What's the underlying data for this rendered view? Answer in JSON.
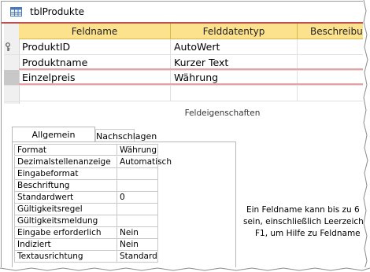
{
  "window": {
    "title": "tblProdukte",
    "icon": "table-icon"
  },
  "grid": {
    "columns": [
      "Feldname",
      "Felddatentyp",
      "Beschreibu"
    ],
    "rows": [
      {
        "name": "ProduktID",
        "type": "AutoWert",
        "description": "",
        "key": true
      },
      {
        "name": "Produktname",
        "type": "Kurzer Text",
        "description": "",
        "key": false
      },
      {
        "name": "Einzelpreis",
        "type": "Währung",
        "description": "",
        "key": false,
        "selected": true
      }
    ],
    "header_color": "#fde28d",
    "selection_color": "#e8a0a2"
  },
  "properties_section_label": "Feldeigenschaften",
  "tabs": [
    {
      "label": "Allgemein",
      "active": true
    },
    {
      "label": "Nachschlagen",
      "active": false
    }
  ],
  "properties": [
    {
      "name": "Format",
      "value": "Währung"
    },
    {
      "name": "Dezimalstellenanzeige",
      "value": "Automatisch"
    },
    {
      "name": "Eingabeformat",
      "value": ""
    },
    {
      "name": "Beschriftung",
      "value": ""
    },
    {
      "name": "Standardwert",
      "value": "0"
    },
    {
      "name": "Gültigkeitsregel",
      "value": ""
    },
    {
      "name": "Gültigkeitsmeldung",
      "value": ""
    },
    {
      "name": "Eingabe erforderlich",
      "value": "Nein"
    },
    {
      "name": "Indiziert",
      "value": "Nein"
    },
    {
      "name": "Textausrichtung",
      "value": "Standard"
    }
  ],
  "help_text": [
    "Ein Feldname kann bis zu 6",
    "sein, einschließlich Leerzeich",
    "F1, um Hilfe zu Feldname"
  ]
}
